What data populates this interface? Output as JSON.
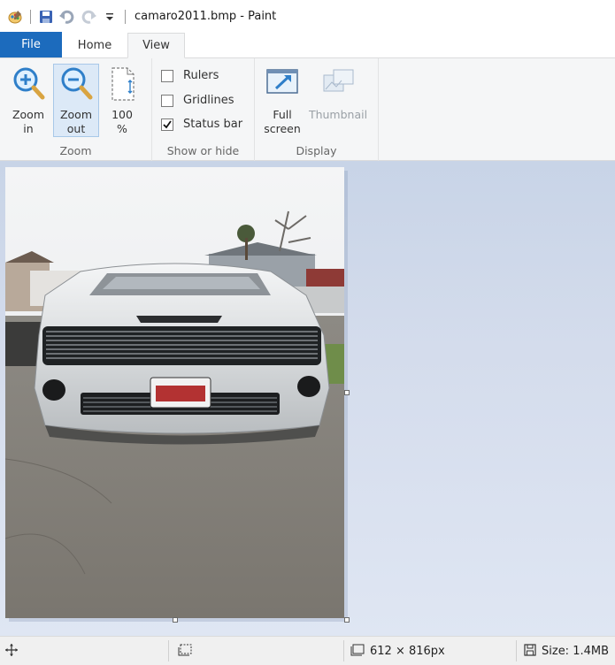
{
  "window": {
    "title": "camaro2011.bmp - Paint"
  },
  "quick_access": {
    "icons": [
      "paint-app-icon",
      "save-icon",
      "undo-icon",
      "redo-icon",
      "customize-dropdown-icon"
    ]
  },
  "tabs": [
    {
      "label": "File",
      "active": false
    },
    {
      "label": "Home",
      "active": false
    },
    {
      "label": "View",
      "active": true
    }
  ],
  "ribbon": {
    "zoom": {
      "group_label": "Zoom",
      "zoom_in_label": "Zoom\nin",
      "zoom_out_label": "Zoom\nout",
      "hundred_label": "100\n%"
    },
    "show_hide": {
      "group_label": "Show or hide",
      "rulers": {
        "label": "Rulers",
        "checked": false
      },
      "gridlines": {
        "label": "Gridlines",
        "checked": false
      },
      "statusbar": {
        "label": "Status bar",
        "checked": true
      }
    },
    "display": {
      "group_label": "Display",
      "full_screen_label": "Full\nscreen",
      "thumbnail_label": "Thumbnail"
    }
  },
  "status": {
    "dimensions": "612 × 816px",
    "size": "Size: 1.4MB"
  },
  "colors": {
    "file_tab": "#1c6bbd",
    "ribbon_bg": "#f5f6f7",
    "workspace": "#d4dcec",
    "icon_blue": "#2f7fc9"
  }
}
